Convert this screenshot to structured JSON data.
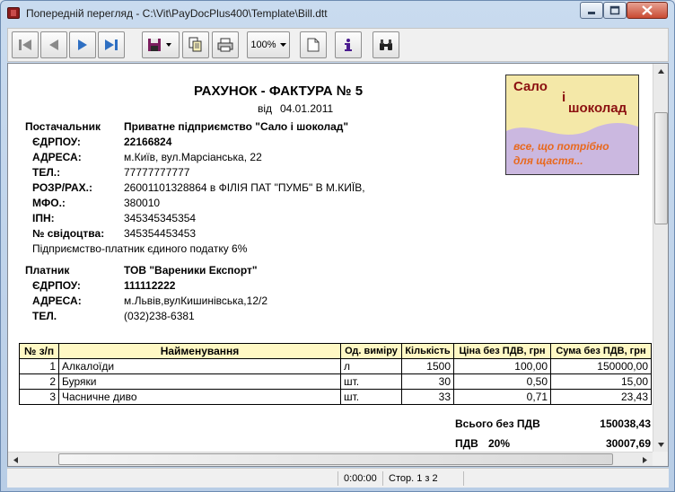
{
  "window": {
    "title": "Попередній перегляд - C:\\Vit\\PayDocPlus400\\Template\\Bill.dtt",
    "min_icon": "minimize-icon",
    "max_icon": "maximize-icon",
    "close_icon": "close-icon"
  },
  "toolbar": {
    "zoom": "100%",
    "icons": [
      "first-page-icon",
      "previous-page-icon",
      "next-page-icon",
      "last-page-icon",
      "save-icon",
      "copy-icon",
      "print-icon",
      "page-setup-icon",
      "info-icon",
      "find-icon"
    ]
  },
  "invoice": {
    "title": "РАХУНОК - ФАКТУРА № 5",
    "date_label": "від",
    "date": "04.01.2011",
    "supplier": {
      "label": "Постачальник",
      "name": "Приватне підприємство \"Сало і шоколад\"",
      "fields": [
        {
          "label": "ЄДРПОУ:",
          "value": "22166824",
          "bold": true
        },
        {
          "label": "АДРЕСА:",
          "value": "м.Київ, вул.Марсіанська, 22"
        },
        {
          "label": "ТЕЛ.:",
          "value": "77777777777"
        },
        {
          "label": "РОЗР/РАХ.:",
          "value": "26001101328864 в ФІЛІЯ ПАТ \"ПУМБ\" В М.КИЇВ,"
        },
        {
          "label": "МФО.:",
          "value": "380010"
        },
        {
          "label": "ІПН:",
          "value": "345345345354"
        },
        {
          "label": "№ свідоцтва:",
          "value": "345354453453"
        }
      ],
      "note": "Підприємство-платник єдиного податку 6%"
    },
    "payer": {
      "label": "Платник",
      "name": "ТОВ \"Вареники Експорт\"",
      "fields": [
        {
          "label": "ЄДРПОУ:",
          "value": "111112222",
          "bold": true
        },
        {
          "label": "АДРЕСА:",
          "value": "м.Львів,вулКишинівська,12/2"
        },
        {
          "label": "ТЕЛ.",
          "value": "(032)238-6381"
        }
      ]
    },
    "logo": {
      "line1": "Сало",
      "line2": "і",
      "line3": "шоколад",
      "slogan1": "все, що потрібно",
      "slogan2": "для щастя..."
    },
    "table": {
      "headers": [
        "№ з/п",
        "Найменування",
        "Од. виміру",
        "Кількість",
        "Ціна без ПДВ, грн",
        "Сума без ПДВ, грн"
      ],
      "rows": [
        [
          "1",
          "Алкалоїди",
          "л",
          "1500",
          "100,00",
          "150000,00"
        ],
        [
          "2",
          "Буряки",
          "шт.",
          "30",
          "0,50",
          "15,00"
        ],
        [
          "3",
          "Часничне диво",
          "шт.",
          "33",
          "0,71",
          "23,43"
        ]
      ]
    },
    "totals": {
      "no_vat_label": "Всього без ПДВ",
      "no_vat_value": "150038,43",
      "vat_label": "ПДВ",
      "vat_rate": "20%",
      "vat_value": "30007,69"
    }
  },
  "status": {
    "time": "0:00:00",
    "page": "Стор. 1 з 2"
  },
  "colors": {
    "header_fill": "#fff8c4",
    "logo_yellow": "#f4e8a8",
    "logo_purple": "#cbb8e0",
    "logo_red": "#8b1010",
    "logo_orange": "#e8691e"
  }
}
